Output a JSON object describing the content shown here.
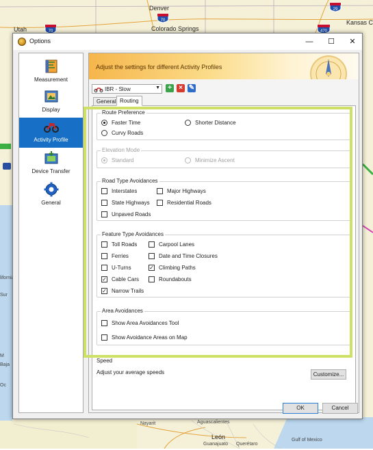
{
  "map": {
    "labels": [
      "Utah",
      "Denver",
      "Colorado Springs",
      "Kansas C",
      "León",
      "Aguascalientes",
      "Nayarit",
      "Gulf of Mexico",
      "Guanajuato",
      "Querétaro",
      "Sur",
      "Baja",
      "Oc",
      "lifornia",
      "M"
    ],
    "highway_shields": [
      "70",
      "70",
      "29",
      "470",
      "25"
    ]
  },
  "window": {
    "title": "Options",
    "controls": [
      "—",
      "☐",
      "✕"
    ]
  },
  "nav": {
    "items": [
      {
        "label": "Measurement",
        "icon": "measurement-icon",
        "active": false
      },
      {
        "label": "Display",
        "icon": "display-icon",
        "active": false
      },
      {
        "label": "Activity Profile",
        "icon": "motorcycle-icon",
        "active": true
      },
      {
        "label": "Device Transfer",
        "icon": "device-transfer-icon",
        "active": false
      },
      {
        "label": "General",
        "icon": "gear-icon",
        "active": false
      }
    ]
  },
  "banner": {
    "text": "Adjust the settings for different Activity Profiles"
  },
  "profile": {
    "selected": "IBR - Slow"
  },
  "tabs": [
    {
      "label": "General",
      "active": false
    },
    {
      "label": "Routing",
      "active": true
    }
  ],
  "route_preference": {
    "title": "Route Preference",
    "options": [
      {
        "label": "Faster Time",
        "checked": true
      },
      {
        "label": "Shorter Distance",
        "checked": false
      },
      {
        "label": "Curvy Roads",
        "checked": false
      }
    ]
  },
  "elevation_mode": {
    "title": "Elevation Mode",
    "disabled": true,
    "options": [
      {
        "label": "Standard",
        "checked": true
      },
      {
        "label": "Minimize Ascent",
        "checked": false
      }
    ]
  },
  "road_type_avoidances": {
    "title": "Road Type Avoidances",
    "options": [
      {
        "label": "Interstates",
        "checked": false
      },
      {
        "label": "Major Highways",
        "checked": false
      },
      {
        "label": "State Highways",
        "checked": false
      },
      {
        "label": "Residential Roads",
        "checked": false
      },
      {
        "label": "Unpaved Roads",
        "checked": false
      }
    ]
  },
  "feature_type_avoidances": {
    "title": "Feature Type Avoidances",
    "options": [
      {
        "label": "Toll Roads",
        "checked": false
      },
      {
        "label": "Carpool Lanes",
        "checked": false
      },
      {
        "label": "Ferries",
        "checked": false
      },
      {
        "label": "Date and Time Closures",
        "checked": false
      },
      {
        "label": "U-Turns",
        "checked": false
      },
      {
        "label": "Climbing Paths",
        "checked": true
      },
      {
        "label": "Cable Cars",
        "checked": true
      },
      {
        "label": "Roundabouts",
        "checked": false
      },
      {
        "label": "Narrow Trails",
        "checked": true
      }
    ]
  },
  "area_avoidances": {
    "title": "Area Avoidances",
    "options": [
      {
        "label": "Show Area Avoidances Tool",
        "checked": false
      },
      {
        "label": "Show Avoidance Areas on Map",
        "checked": false
      }
    ]
  },
  "speed": {
    "title": "Speed",
    "description": "Adjust your average speeds",
    "button": "Customize..."
  },
  "footer": {
    "ok": "OK",
    "cancel": "Cancel"
  },
  "colors": {
    "accent": "#1870c6",
    "highlight": "#cfe067",
    "banner_start": "#f6b64b"
  }
}
